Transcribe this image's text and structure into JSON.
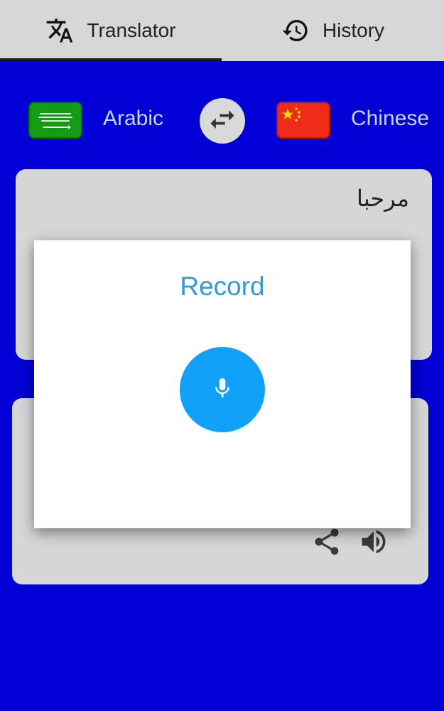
{
  "tabs": [
    {
      "label": "Translator",
      "icon": "translate-icon"
    },
    {
      "label": "History",
      "icon": "history-icon"
    }
  ],
  "languages": {
    "source": "Arabic",
    "target": "Chinese"
  },
  "input": {
    "text": "مرحبا"
  },
  "dialog": {
    "title": "Record"
  },
  "colors": {
    "background": "#0000d4",
    "tabbar": "#d7d7d7",
    "card": "#d6d6d6",
    "accent": "#0fa2f8",
    "dialog_title": "#2e9bd6"
  }
}
